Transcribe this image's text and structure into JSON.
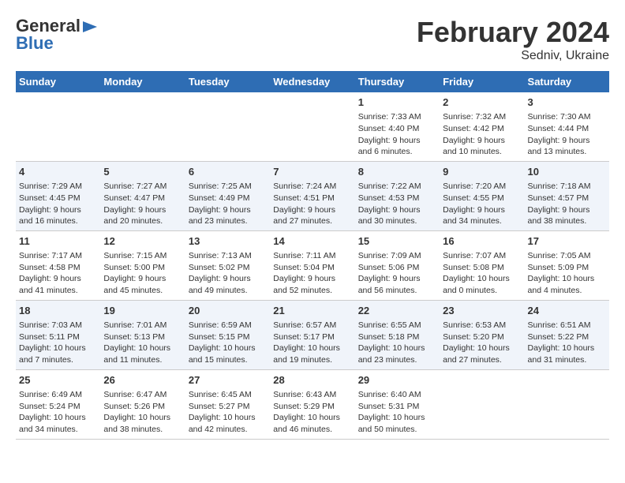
{
  "header": {
    "logo_general": "General",
    "logo_blue": "Blue",
    "title": "February 2024",
    "subtitle": "Sedniv, Ukraine"
  },
  "weekdays": [
    "Sunday",
    "Monday",
    "Tuesday",
    "Wednesday",
    "Thursday",
    "Friday",
    "Saturday"
  ],
  "weeks": [
    [
      {
        "day": "",
        "content": ""
      },
      {
        "day": "",
        "content": ""
      },
      {
        "day": "",
        "content": ""
      },
      {
        "day": "",
        "content": ""
      },
      {
        "day": "1",
        "content": "Sunrise: 7:33 AM\nSunset: 4:40 PM\nDaylight: 9 hours\nand 6 minutes."
      },
      {
        "day": "2",
        "content": "Sunrise: 7:32 AM\nSunset: 4:42 PM\nDaylight: 9 hours\nand 10 minutes."
      },
      {
        "day": "3",
        "content": "Sunrise: 7:30 AM\nSunset: 4:44 PM\nDaylight: 9 hours\nand 13 minutes."
      }
    ],
    [
      {
        "day": "4",
        "content": "Sunrise: 7:29 AM\nSunset: 4:45 PM\nDaylight: 9 hours\nand 16 minutes."
      },
      {
        "day": "5",
        "content": "Sunrise: 7:27 AM\nSunset: 4:47 PM\nDaylight: 9 hours\nand 20 minutes."
      },
      {
        "day": "6",
        "content": "Sunrise: 7:25 AM\nSunset: 4:49 PM\nDaylight: 9 hours\nand 23 minutes."
      },
      {
        "day": "7",
        "content": "Sunrise: 7:24 AM\nSunset: 4:51 PM\nDaylight: 9 hours\nand 27 minutes."
      },
      {
        "day": "8",
        "content": "Sunrise: 7:22 AM\nSunset: 4:53 PM\nDaylight: 9 hours\nand 30 minutes."
      },
      {
        "day": "9",
        "content": "Sunrise: 7:20 AM\nSunset: 4:55 PM\nDaylight: 9 hours\nand 34 minutes."
      },
      {
        "day": "10",
        "content": "Sunrise: 7:18 AM\nSunset: 4:57 PM\nDaylight: 9 hours\nand 38 minutes."
      }
    ],
    [
      {
        "day": "11",
        "content": "Sunrise: 7:17 AM\nSunset: 4:58 PM\nDaylight: 9 hours\nand 41 minutes."
      },
      {
        "day": "12",
        "content": "Sunrise: 7:15 AM\nSunset: 5:00 PM\nDaylight: 9 hours\nand 45 minutes."
      },
      {
        "day": "13",
        "content": "Sunrise: 7:13 AM\nSunset: 5:02 PM\nDaylight: 9 hours\nand 49 minutes."
      },
      {
        "day": "14",
        "content": "Sunrise: 7:11 AM\nSunset: 5:04 PM\nDaylight: 9 hours\nand 52 minutes."
      },
      {
        "day": "15",
        "content": "Sunrise: 7:09 AM\nSunset: 5:06 PM\nDaylight: 9 hours\nand 56 minutes."
      },
      {
        "day": "16",
        "content": "Sunrise: 7:07 AM\nSunset: 5:08 PM\nDaylight: 10 hours\nand 0 minutes."
      },
      {
        "day": "17",
        "content": "Sunrise: 7:05 AM\nSunset: 5:09 PM\nDaylight: 10 hours\nand 4 minutes."
      }
    ],
    [
      {
        "day": "18",
        "content": "Sunrise: 7:03 AM\nSunset: 5:11 PM\nDaylight: 10 hours\nand 7 minutes."
      },
      {
        "day": "19",
        "content": "Sunrise: 7:01 AM\nSunset: 5:13 PM\nDaylight: 10 hours\nand 11 minutes."
      },
      {
        "day": "20",
        "content": "Sunrise: 6:59 AM\nSunset: 5:15 PM\nDaylight: 10 hours\nand 15 minutes."
      },
      {
        "day": "21",
        "content": "Sunrise: 6:57 AM\nSunset: 5:17 PM\nDaylight: 10 hours\nand 19 minutes."
      },
      {
        "day": "22",
        "content": "Sunrise: 6:55 AM\nSunset: 5:18 PM\nDaylight: 10 hours\nand 23 minutes."
      },
      {
        "day": "23",
        "content": "Sunrise: 6:53 AM\nSunset: 5:20 PM\nDaylight: 10 hours\nand 27 minutes."
      },
      {
        "day": "24",
        "content": "Sunrise: 6:51 AM\nSunset: 5:22 PM\nDaylight: 10 hours\nand 31 minutes."
      }
    ],
    [
      {
        "day": "25",
        "content": "Sunrise: 6:49 AM\nSunset: 5:24 PM\nDaylight: 10 hours\nand 34 minutes."
      },
      {
        "day": "26",
        "content": "Sunrise: 6:47 AM\nSunset: 5:26 PM\nDaylight: 10 hours\nand 38 minutes."
      },
      {
        "day": "27",
        "content": "Sunrise: 6:45 AM\nSunset: 5:27 PM\nDaylight: 10 hours\nand 42 minutes."
      },
      {
        "day": "28",
        "content": "Sunrise: 6:43 AM\nSunset: 5:29 PM\nDaylight: 10 hours\nand 46 minutes."
      },
      {
        "day": "29",
        "content": "Sunrise: 6:40 AM\nSunset: 5:31 PM\nDaylight: 10 hours\nand 50 minutes."
      },
      {
        "day": "",
        "content": ""
      },
      {
        "day": "",
        "content": ""
      }
    ]
  ]
}
